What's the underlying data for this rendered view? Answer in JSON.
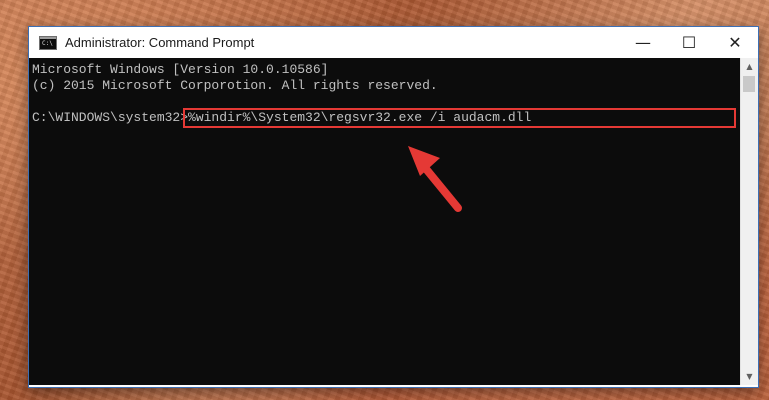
{
  "window": {
    "title": "Administrator: Command Prompt",
    "icon": "cmd-icon",
    "icon_text": "C:\\",
    "controls": {
      "minimize": "—",
      "maximize": "☐",
      "close": "✕"
    }
  },
  "console": {
    "lines": [
      "Microsoft Windows [Version 10.0.10586]",
      "(c) 2015 Microsoft Corporotion. All rights reserved.",
      "",
      "C:\\WINDOWS\\system32>%windir%\\System32\\regsvr32.exe /i audacm.dll"
    ]
  },
  "scrollbar": {
    "up_arrow": "▲",
    "down_arrow": "▼"
  },
  "colors": {
    "console_bg": "#0c0c0c",
    "console_text": "#c0c0c0",
    "highlight": "#e53935"
  }
}
